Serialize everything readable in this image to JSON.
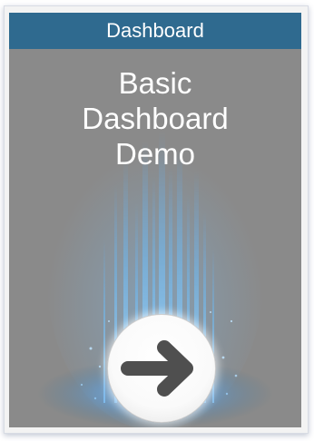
{
  "tile": {
    "header_label": "Dashboard",
    "title_lines": [
      "Basic",
      "Dashboard",
      "Demo"
    ]
  },
  "icons": {
    "go": "arrow-right-icon"
  },
  "colors": {
    "header_bg": "#2f6a8f",
    "tile_bg": "#8a8a8a",
    "glow": "#5fb6ff"
  }
}
